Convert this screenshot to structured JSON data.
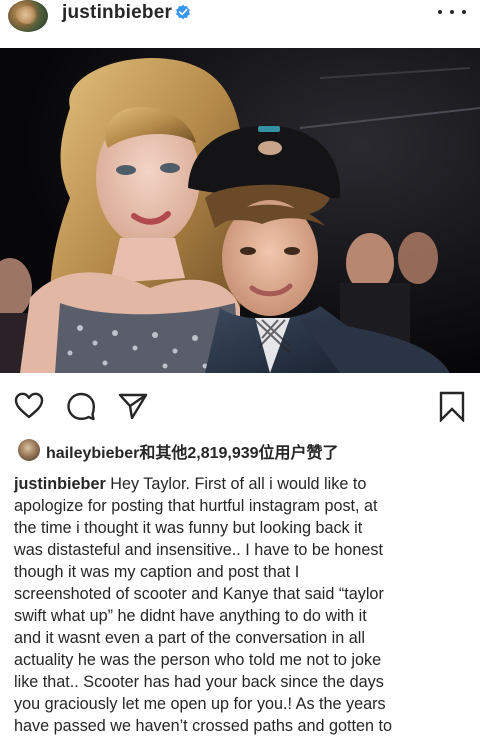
{
  "header": {
    "username": "justinbieber",
    "verified_icon": "verified-badge-icon",
    "more_icon": "more-options-icon"
  },
  "photo": {
    "description_icon": "post-photo"
  },
  "actions": {
    "like_icon": "heart-icon",
    "comment_icon": "comment-icon",
    "share_icon": "send-icon",
    "save_icon": "bookmark-icon"
  },
  "likes": {
    "liker_username": "haileybieber",
    "rest_text": "和其他2,819,939位用户赞了"
  },
  "caption": {
    "username": "justinbieber",
    "text": " Hey Taylor. First of all i would like to\napologize for posting that hurtful instagram post, at\nthe time i thought it was funny but looking back it\nwas distasteful and insensitive.. I have to be honest\nthough it was my caption and post that I\nscreenshoted of scooter and  Kanye that said “taylor\nswift what up” he didnt have anything to do with it\nand it wasnt even a part of the conversation in all\nactuality he was the person who told me not to joke\nlike that.. Scooter has had your back since the days\nyou graciously let me open up for you.! As the years\nhave passed we haven’t crossed paths and gotten to"
  },
  "colors": {
    "text": "#262626",
    "verified_blue": "#3897f0",
    "photo_bg": "#0c0c0e"
  }
}
